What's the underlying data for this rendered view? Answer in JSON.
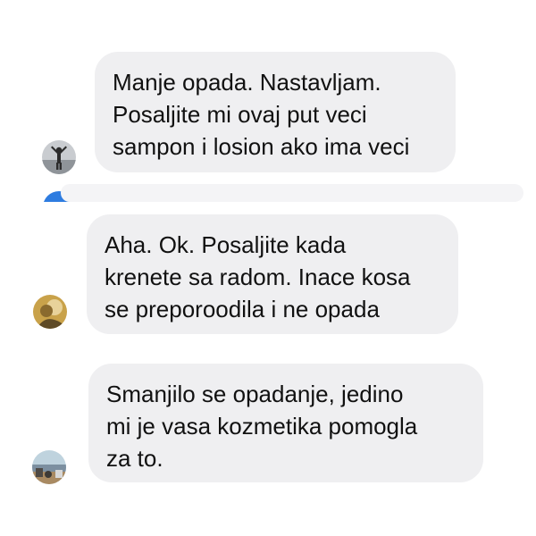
{
  "messages": [
    {
      "lines": [
        "Manje opada. Nastavljam.",
        "Posaljite mi ovaj put veci",
        "sampon i losion ako ima veci"
      ],
      "avatar_icon": "person-silhouette-avatar"
    },
    {
      "lines": [
        "Aha. Ok. Posaljite kada",
        "krenete sa radom. Inace kosa",
        "se preporoodila i ne opada"
      ],
      "avatar_icon": "golden-portrait-avatar"
    },
    {
      "lines": [
        "Smanjilo se opadanje, jedino",
        "mi je vasa kozmetika pomogla",
        "za to."
      ],
      "avatar_icon": "landscape-avatar"
    }
  ],
  "colors": {
    "bubble": "#efeff1",
    "text": "#111111",
    "fragment_dot": "#2e7ce0"
  }
}
